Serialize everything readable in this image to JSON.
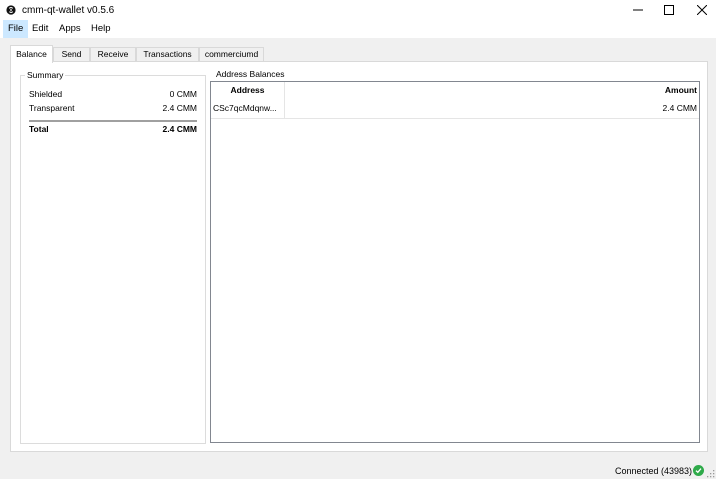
{
  "window": {
    "title": "cmm-qt-wallet v0.5.6",
    "app_icon": "commercium-logo-icon",
    "controls": [
      "minimize-icon",
      "maximize-icon",
      "close-icon"
    ]
  },
  "menu": {
    "items": [
      {
        "label": "File",
        "active": true
      },
      {
        "label": "Edit"
      },
      {
        "label": "Apps"
      },
      {
        "label": "Help"
      }
    ]
  },
  "tabs": [
    {
      "label": "Balance",
      "selected": true
    },
    {
      "label": "Send"
    },
    {
      "label": "Receive"
    },
    {
      "label": "Transactions"
    },
    {
      "label": "commerciumd"
    }
  ],
  "summary": {
    "title": "Summary",
    "shielded_label": "Shielded",
    "shielded_value": "0 CMM",
    "transparent_label": "Transparent",
    "transparent_value": "2.4 CMM",
    "total_label": "Total",
    "total_value": "2.4 CMM"
  },
  "address_balances": {
    "title": "Address Balances",
    "columns": [
      "Address",
      "Amount"
    ],
    "rows": [
      {
        "address": "CSc7qcMdqnw...",
        "amount": "2.4 CMM"
      }
    ]
  },
  "status": {
    "text": "Connected (43983)",
    "icon": "checkmark-circle-icon",
    "color": "#2faa4a"
  }
}
